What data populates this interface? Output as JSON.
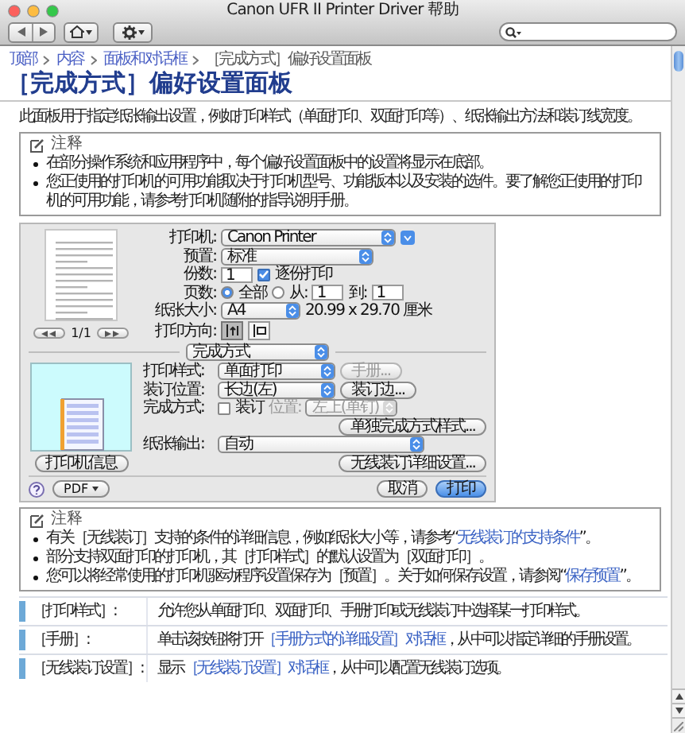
{
  "window": {
    "title": "Canon UFR II Printer Driver 帮助"
  },
  "breadcrumb": [
    {
      "label": "顶部",
      "current": false
    },
    {
      "label": "内容",
      "current": false
    },
    {
      "label": "面板和对话框",
      "current": false
    },
    {
      "label": "［完成方式］偏好设置面板",
      "current": true
    }
  ],
  "heading": "［完成方式］偏好设置面板",
  "intro": "此面板用于指定纸张输出设置，例如打印样式（单面打印、双面打印等）、纸张输出方法和装订线宽度。",
  "note_before": {
    "title": "注释",
    "items": [
      {
        "text": "在部分操作系统和应用程序中，每个偏好设置面板中的设置将显示在底部。"
      },
      {
        "text": "您正使用的打印机的可用功能取决于打印机型号、功能版本以及安装的选件。要了解您正使用的打印机的可用功能，请参考打印机随附的指导说明手册。"
      }
    ]
  },
  "print_dialog": {
    "page_counter": "1/1",
    "fields": [
      {
        "kind": "popup_disclosure",
        "label": "打印机:",
        "value": "Canon Printer"
      },
      {
        "kind": "popup",
        "label": "预置:",
        "value": "标准"
      },
      {
        "kind": "copies",
        "label": "份数:",
        "value": "1",
        "checkbox": {
          "label": "逐份打印",
          "checked": true
        }
      },
      {
        "kind": "pages",
        "label": "页数:",
        "options": [
          {
            "label": "全部",
            "selected": true
          },
          {
            "label": "从:",
            "selected": false
          }
        ],
        "from": "1",
        "to_label": "到:",
        "to": "1"
      },
      {
        "kind": "popup_info",
        "label": "纸张大小:",
        "value": "A4",
        "info": "20.99 x 29.70 厘米"
      },
      {
        "kind": "orientation",
        "label": "打印方向:",
        "options": [
          {
            "selected": true
          },
          {
            "selected": false
          }
        ]
      }
    ],
    "panel": "完成方式",
    "preview_button": "打印机信息",
    "settings": [
      {
        "kind": "popup_button",
        "label": "打印样式:",
        "value": "单面打印",
        "button": {
          "label": "手册...",
          "disabled": true
        }
      },
      {
        "kind": "popup_button",
        "label": "装订位置:",
        "value": "长边(左)",
        "button": {
          "label": "装订边...",
          "disabled": false
        }
      },
      {
        "kind": "checkbox_popup",
        "label": "完成方式:",
        "checkbox": {
          "label": "装订",
          "checked": false
        },
        "sub_label": "位置:",
        "value": "左上(单钉)",
        "disabled": true
      },
      {
        "kind": "button",
        "label": "单独完成方式样式..."
      },
      {
        "kind": "popup",
        "label": "纸张输出:",
        "value": "自动"
      },
      {
        "kind": "button",
        "label": "无线装订详细设置..."
      }
    ],
    "pdf_button": "PDF",
    "buttons": [
      {
        "label": "取消",
        "default": false
      },
      {
        "label": "打印",
        "default": true
      }
    ]
  },
  "note_after": {
    "title": "注释",
    "items": [
      {
        "text": "有关［无线装订］支持的条件的详细信息，例如纸张大小等，请参考“",
        "link": "无线装订的支持条件",
        "after": "”。"
      },
      {
        "text": "部分支持双面打印的打印机，其［打印样式］的默认设置为［双面打印］。"
      },
      {
        "text": "您可以将经常使用的打印机驱动程序设置保存为［预置］。关于如何保存设置，请参阅“",
        "link": "保存预置",
        "after": "”。"
      }
    ]
  },
  "definitions": [
    {
      "term": "［打印样式］:",
      "description": {
        "text": "允许您从单面打印、双面打印、手册打印或无线装订中选择某一打印样式。"
      }
    },
    {
      "term": "［手册］:",
      "description": {
        "text": "单击该按钮将打开",
        "link": "［手册方式的详细设置］对话框",
        "after": "，从中可以指定详细的手册设置。"
      }
    },
    {
      "term": "［无线装订设置］:",
      "description": {
        "text": "显示",
        "link": "［无线装订设置］对话框",
        "after": "，从中可以配置无线装订选项。"
      }
    }
  ]
}
